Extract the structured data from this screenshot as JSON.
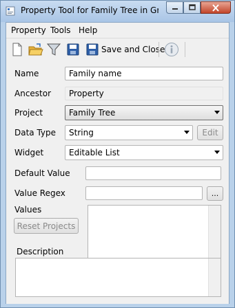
{
  "window": {
    "title": "Property Tool for Family Tree in Gra..."
  },
  "menu": {
    "items": [
      "Property",
      "Tools",
      "Help"
    ]
  },
  "toolbar": {
    "save_close_label": "Save and Close"
  },
  "form": {
    "name_label": "Name",
    "name_value": "Family name",
    "ancestor_label": "Ancestor",
    "ancestor_value": "Property",
    "project_label": "Project",
    "project_value": "Family Tree",
    "data_type_label": "Data Type",
    "data_type_value": "String",
    "edit_label": "Edit",
    "widget_label": "Widget",
    "widget_value": "Editable List",
    "default_value_label": "Default Value",
    "default_value_value": "",
    "value_regex_label": "Value Regex",
    "value_regex_value": "",
    "browse_label": "...",
    "values_label": "Values",
    "reset_projects_label": "Reset Projects",
    "description_label": "Description"
  },
  "colors": {
    "title_bar": "#b9d1ea",
    "close_button": "#c2452a",
    "client": "#f0f0f0"
  }
}
